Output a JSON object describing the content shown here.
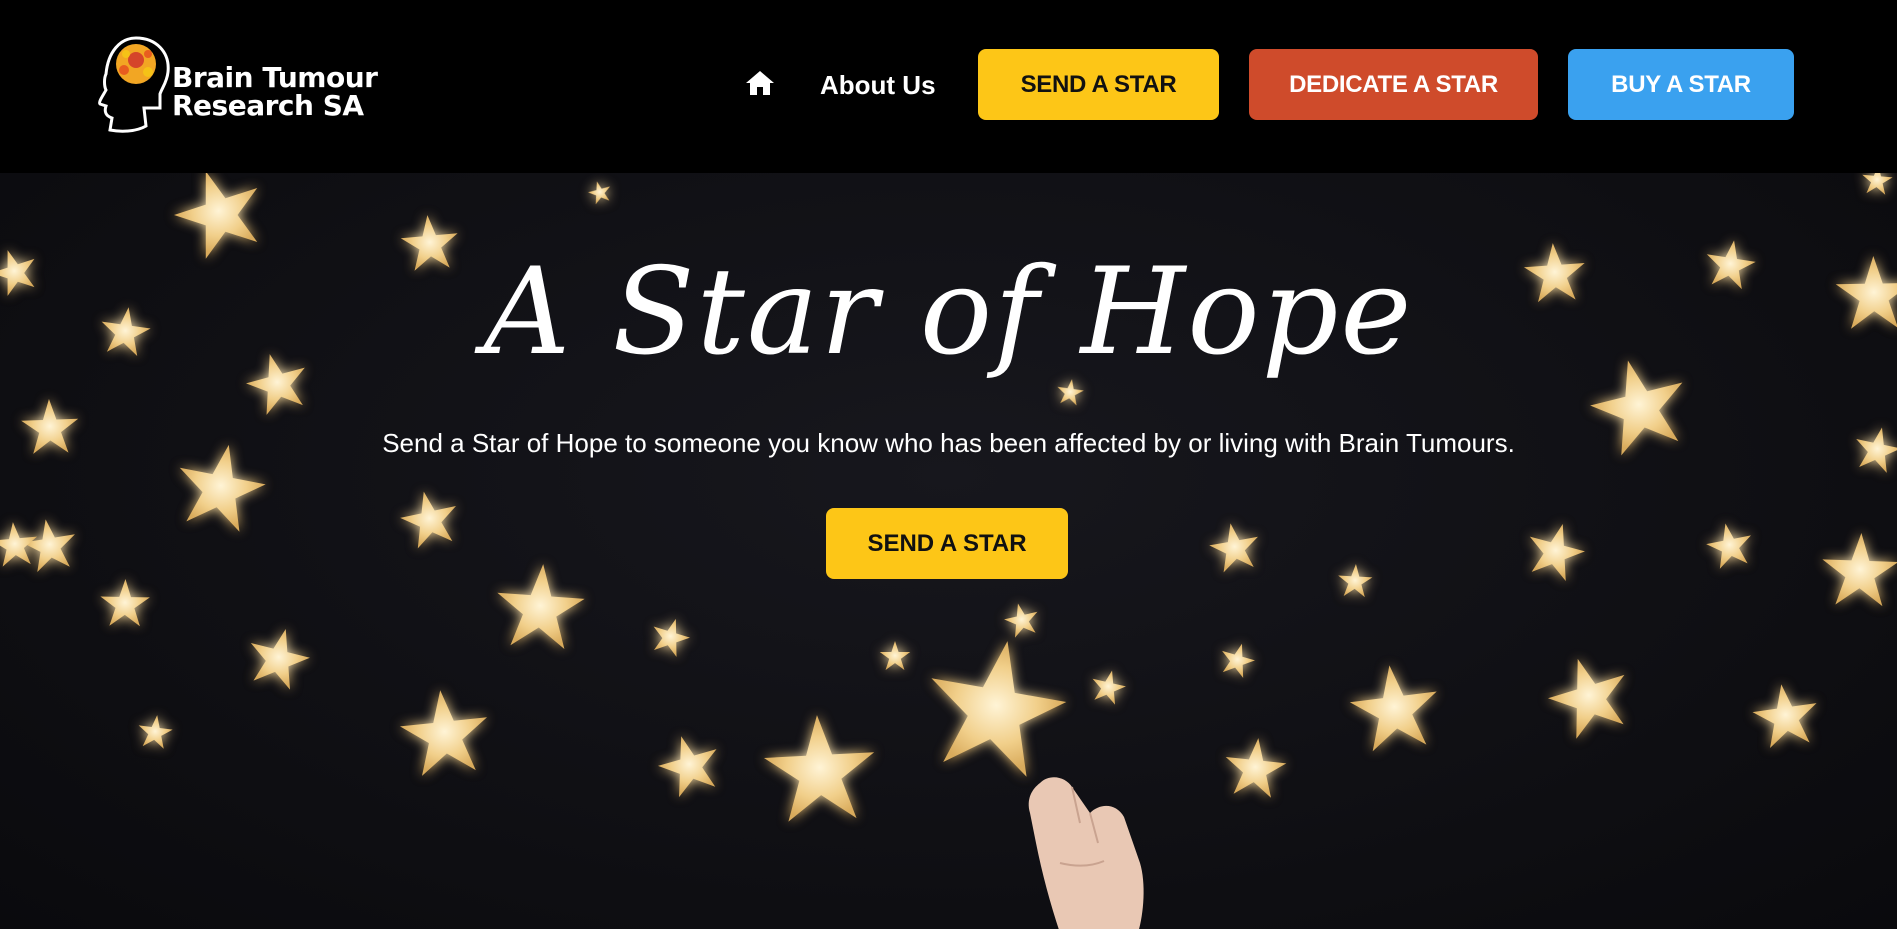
{
  "header": {
    "logo": {
      "line1": "Brain Tumour",
      "line2": "Research SA",
      "icon": "brain-head-icon"
    },
    "nav": {
      "home_icon": "home-icon",
      "about_label": "About Us"
    },
    "buttons": {
      "send_label": "SEND A STAR",
      "dedicate_label": "DEDICATE A STAR",
      "buy_label": "BUY A STAR"
    }
  },
  "hero": {
    "title": "A Star of Hope",
    "subtitle": "Send a Star of Hope to someone you know who has been affected by or living with Brain Tumours.",
    "cta_label": "SEND A STAR"
  },
  "colors": {
    "header_bg": "#000000",
    "send": "#fdc617",
    "dedicate": "#cf4b2b",
    "buy": "#3aa1ef",
    "star": "#f1cf8a"
  }
}
